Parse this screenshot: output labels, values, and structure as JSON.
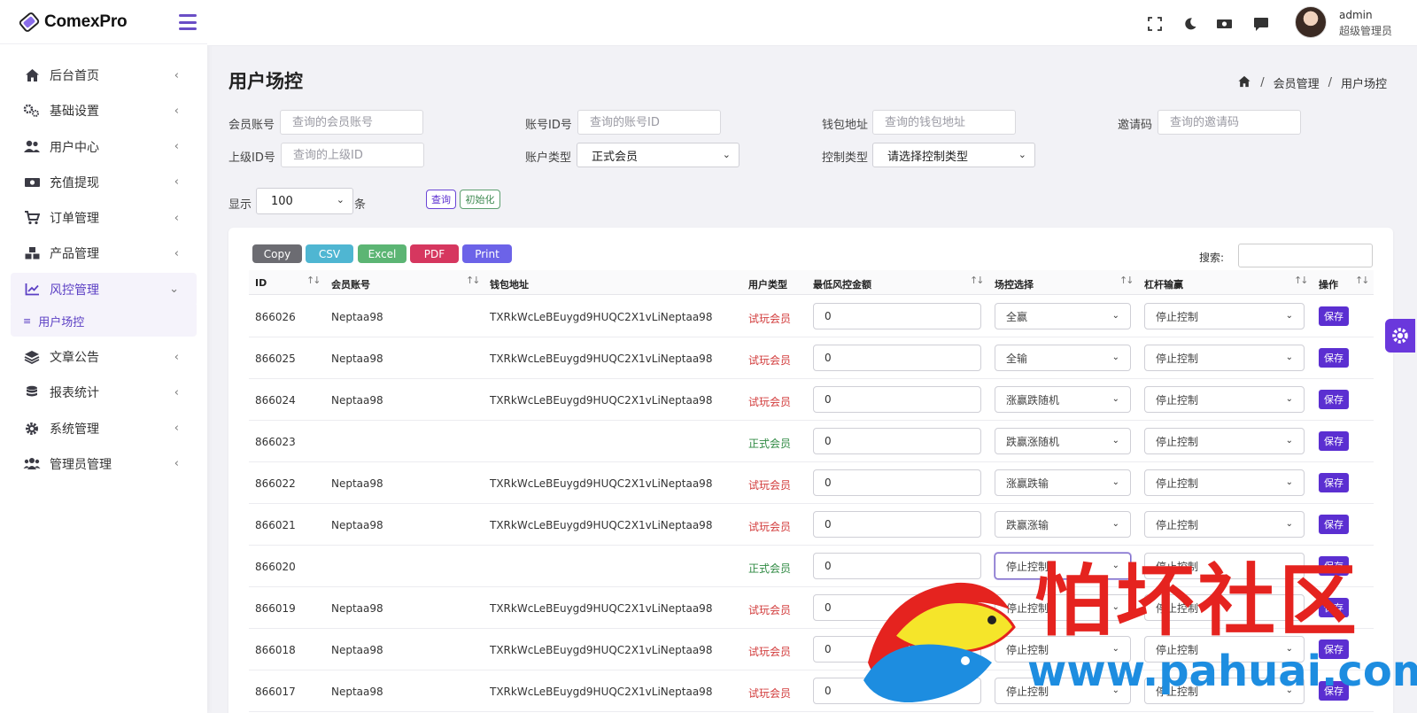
{
  "brand": {
    "name": "ComexPro"
  },
  "sidebar": {
    "items": [
      {
        "label": "后台首页",
        "icon": "home-icon"
      },
      {
        "label": "基础设置",
        "icon": "cogs-icon"
      },
      {
        "label": "用户中心",
        "icon": "users-icon"
      },
      {
        "label": "充值提现",
        "icon": "money-icon"
      },
      {
        "label": "订单管理",
        "icon": "cart-icon"
      },
      {
        "label": "产品管理",
        "icon": "cubes-icon"
      },
      {
        "label": "风控管理",
        "icon": "chart-line-icon",
        "expanded": true
      },
      {
        "label": "文章公告",
        "icon": "layers-icon"
      },
      {
        "label": "报表统计",
        "icon": "database-icon"
      },
      {
        "label": "系统管理",
        "icon": "gear-icon"
      },
      {
        "label": "管理员管理",
        "icon": "user-group-icon"
      }
    ],
    "sub_item": "用户场控"
  },
  "topbar": {
    "user_name": "admin",
    "user_role": "超级管理员"
  },
  "page": {
    "title": "用户场控",
    "breadcrumb": [
      "会员管理",
      "用户场控"
    ]
  },
  "filters": {
    "member_account": {
      "label": "会员账号",
      "placeholder": "查询的会员账号"
    },
    "account_id": {
      "label": "账号ID号",
      "placeholder": "查询的账号ID"
    },
    "wallet": {
      "label": "钱包地址",
      "placeholder": "查询的钱包地址"
    },
    "invite": {
      "label": "邀请码",
      "placeholder": "查询的邀请码"
    },
    "parent_id": {
      "label": "上级ID号",
      "placeholder": "查询的上级ID"
    },
    "account_type": {
      "label": "账户类型",
      "value": "正式会员"
    },
    "control_type": {
      "label": "控制类型",
      "value": "请选择控制类型"
    },
    "show_label": "显示",
    "show_value": "100",
    "show_unit": "条",
    "query_button": "查询",
    "reset_button": "初始化"
  },
  "export": {
    "copy": "Copy",
    "csv": "CSV",
    "excel": "Excel",
    "pdf": "PDF",
    "print": "Print",
    "colors": {
      "copy": "#6c6c72",
      "csv": "#4fb6d2",
      "excel": "#5cb574",
      "pdf": "#d6375f",
      "print": "#6c63e8"
    }
  },
  "search_label": "搜索:",
  "table": {
    "headers": [
      "ID",
      "会员账号",
      "钱包地址",
      "用户类型",
      "最低风控金额",
      "场控选择",
      "杠杆输赢",
      "操作"
    ],
    "rows": [
      {
        "id": "866026",
        "account": "Neptaa98",
        "wallet": "TXRkWcLeBEuygd9HUQC2X1vLiNeptaa98",
        "type": "试玩会员",
        "amount": "0",
        "control": "全赢",
        "leverage": "停止控制",
        "action": "保存"
      },
      {
        "id": "866025",
        "account": "Neptaa98",
        "wallet": "TXRkWcLeBEuygd9HUQC2X1vLiNeptaa98",
        "type": "试玩会员",
        "amount": "0",
        "control": "全输",
        "leverage": "停止控制",
        "action": "保存"
      },
      {
        "id": "866024",
        "account": "Neptaa98",
        "wallet": "TXRkWcLeBEuygd9HUQC2X1vLiNeptaa98",
        "type": "试玩会员",
        "amount": "0",
        "control": "涨赢跌随机",
        "leverage": "停止控制",
        "action": "保存"
      },
      {
        "id": "866023",
        "account": "",
        "wallet": "",
        "type": "正式会员",
        "amount": "0",
        "control": "跌赢涨随机",
        "leverage": "停止控制",
        "action": "保存"
      },
      {
        "id": "866022",
        "account": "Neptaa98",
        "wallet": "TXRkWcLeBEuygd9HUQC2X1vLiNeptaa98",
        "type": "试玩会员",
        "amount": "0",
        "control": "涨赢跌输",
        "leverage": "停止控制",
        "action": "保存"
      },
      {
        "id": "866021",
        "account": "Neptaa98",
        "wallet": "TXRkWcLeBEuygd9HUQC2X1vLiNeptaa98",
        "type": "试玩会员",
        "amount": "0",
        "control": "跌赢涨输",
        "leverage": "停止控制",
        "action": "保存"
      },
      {
        "id": "866020",
        "account": "",
        "wallet": "",
        "type": "正式会员",
        "amount": "0",
        "control": "停止控制",
        "leverage": "停止控制",
        "action": "保存"
      },
      {
        "id": "866019",
        "account": "Neptaa98",
        "wallet": "TXRkWcLeBEuygd9HUQC2X1vLiNeptaa98",
        "type": "试玩会员",
        "amount": "0",
        "control": "停止控制",
        "leverage": "停止控制",
        "action": "保存"
      },
      {
        "id": "866018",
        "account": "Neptaa98",
        "wallet": "TXRkWcLeBEuygd9HUQC2X1vLiNeptaa98",
        "type": "试玩会员",
        "amount": "0",
        "control": "停止控制",
        "leverage": "停止控制",
        "action": "保存"
      },
      {
        "id": "866017",
        "account": "Neptaa98",
        "wallet": "TXRkWcLeBEuygd9HUQC2X1vLiNeptaa98",
        "type": "试玩会员",
        "amount": "0",
        "control": "停止控制",
        "leverage": "停止控制",
        "action": "保存"
      }
    ]
  },
  "watermark": {
    "text": "怕坏社区",
    "url": "www.pahuai.com"
  },
  "colors": {
    "accent": "#5b2fd1",
    "trial": "#d23b3b",
    "formal": "#2f8a43"
  }
}
